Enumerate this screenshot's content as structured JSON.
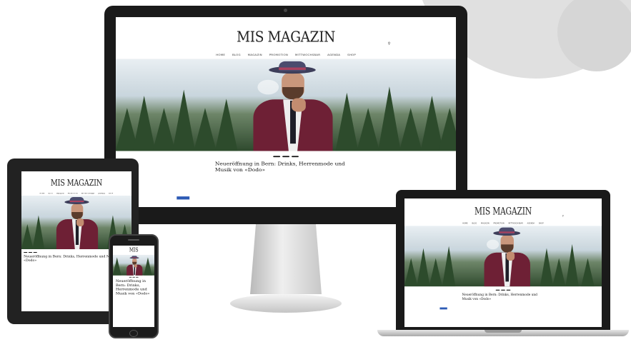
{
  "site": {
    "logo": "MIS MAGAZIN",
    "search_icon": "search-icon",
    "top_links": [
      "",
      "",
      " "
    ],
    "menu": [
      "HOME",
      "BLOG",
      "MAGAZIN",
      "PROMOTION",
      "MITTWOCHSBAR",
      "AGENDA",
      "SHOP"
    ],
    "tags": [
      "",
      "",
      " "
    ],
    "post_title": "Neueröffnung in Bern: Drinks, Herrenmode und Musik von «Dodo»",
    "post_meta": "",
    "lead": "",
    "body": ""
  },
  "colors": {
    "accent": "#2d5bb5",
    "coat": "#6e2035",
    "forest": "#2d4b2c",
    "device_frame": "#1a1a1a"
  }
}
